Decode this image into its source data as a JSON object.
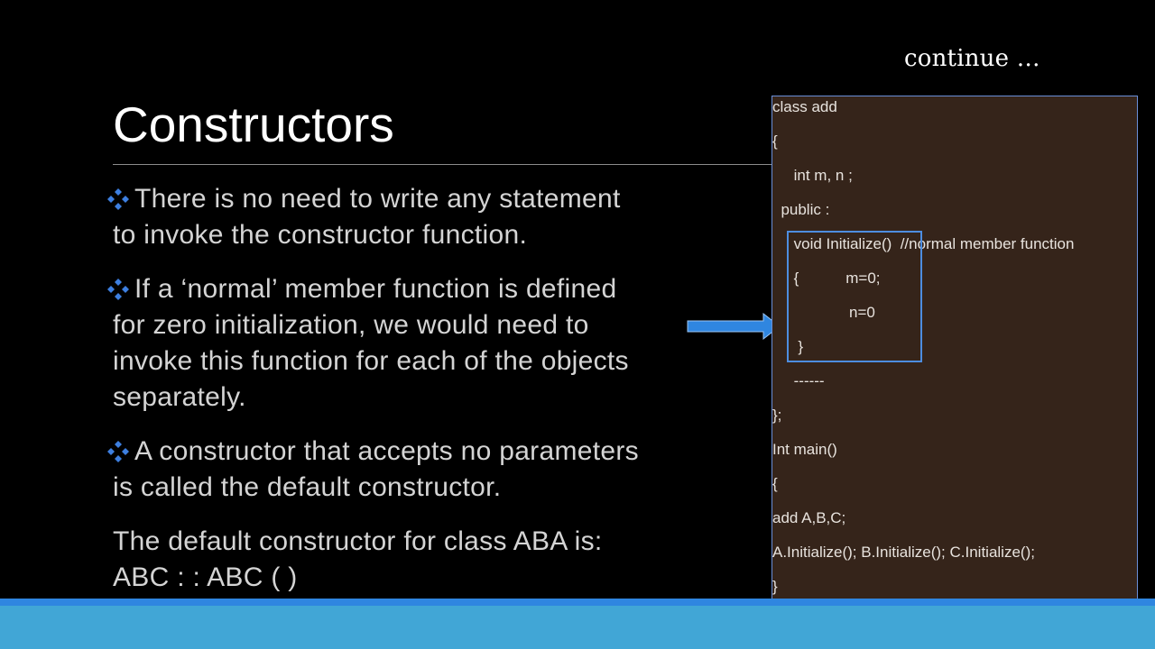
{
  "header": {
    "continue_label": "continue …"
  },
  "slide": {
    "title": "Constructors"
  },
  "bullets": [
    {
      "lines": [
        "There is no need to write any statement",
        "to invoke the constructor function."
      ]
    },
    {
      "lines": [
        "If a ‘normal’ member function is defined",
        "for zero initialization, we would need to",
        "invoke this function for each of the objects",
        "separately."
      ]
    },
    {
      "lines": [
        "A constructor that accepts no parameters",
        "is called the default constructor."
      ]
    }
  ],
  "plain_lines": [
    "The default constructor for class ABA is:",
    "ABC : : ABC ( )"
  ],
  "code": {
    "lines": [
      "class add",
      "{",
      "     int m, n ;",
      "  public :",
      "     void Initialize()  //normal member function",
      "     {           m=0;",
      "                  n=0",
      "      }",
      "     ------",
      "};",
      "Int main()",
      "{",
      "add A,B,C;",
      "A.Initialize(); B.Initialize(); C.Initialize();",
      "}"
    ]
  },
  "colors": {
    "bullet_diamond": "#3d7fe0",
    "arrow": "#2f86e0",
    "code_bg": "#35241a",
    "footer": "#41a6d6"
  },
  "icons": {
    "bullet": "diamond-cluster-icon",
    "arrow": "right-arrow-icon"
  }
}
